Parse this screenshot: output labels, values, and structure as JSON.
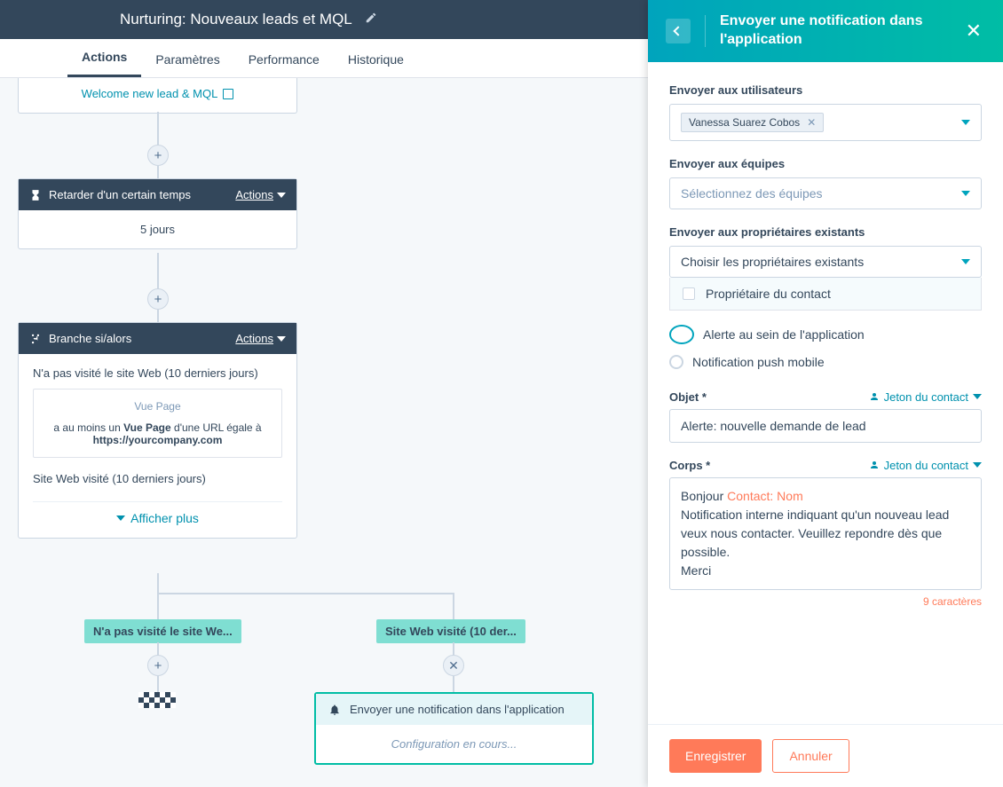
{
  "header": {
    "title": "Nurturing: Nouveaux leads et MQL"
  },
  "tabs": [
    "Actions",
    "Paramètres",
    "Performance",
    "Historique"
  ],
  "active_tab": 0,
  "cards": {
    "welcome": {
      "link_text": "Welcome new lead & MQL"
    },
    "delay": {
      "header": "Retarder d'un certain temps",
      "actions": "Actions",
      "body": "5 jours"
    },
    "branch": {
      "header": "Branche si/alors",
      "actions": "Actions",
      "cond_title": "N'a pas visité le site Web (10 derniers jours)",
      "rule_title": "Vue Page",
      "rule_pre": "a au moins un ",
      "rule_bold1": "Vue Page",
      "rule_mid": " d'une URL égale à ",
      "rule_bold2": "https://yourcompany.com",
      "link2": "Site Web visité (10 derniers jours)",
      "show_more": "Afficher plus"
    },
    "branches": {
      "left": "N'a pas visité le site We...",
      "right": "Site Web visité (10 der..."
    },
    "notif_card": {
      "title": "Envoyer une notification dans l'application",
      "status": "Configuration en cours..."
    }
  },
  "panel": {
    "title": "Envoyer une notification dans l'application",
    "users_label": "Envoyer aux utilisateurs",
    "user_chip": "Vanessa Suarez Cobos",
    "teams_label": "Envoyer aux équipes",
    "teams_placeholder": "Sélectionnez des équipes",
    "owners_label": "Envoyer aux propriétaires existants",
    "owners_placeholder": "Choisir les propriétaires existants",
    "owners_option": "Propriétaire du contact",
    "radio1": "Alerte au sein de l'application",
    "radio2": "Notification push mobile",
    "subject_label": "Objet *",
    "token_link": "Jeton du contact",
    "subject_value": "Alerte: nouvelle demande de lead",
    "body_label": "Corps *",
    "body_pre": "Bonjour ",
    "body_token": "Contact: Nom",
    "body_line2": "Notification interne indiquant qu'un nouveau lead veux nous contacter. Veuillez repondre dès que possible.",
    "body_line3": "Merci",
    "char_count": "9 caractères",
    "save": "Enregistrer",
    "cancel": "Annuler"
  }
}
